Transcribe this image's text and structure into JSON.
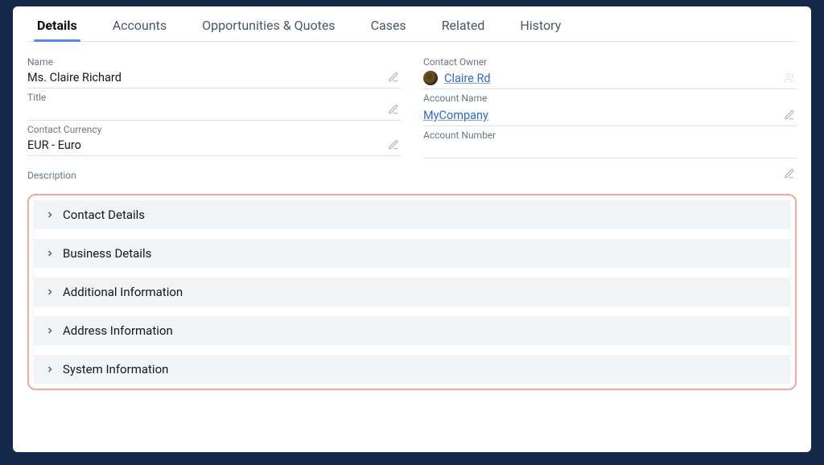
{
  "tabs": {
    "details": "Details",
    "accounts": "Accounts",
    "opps": "Opportunities & Quotes",
    "cases": "Cases",
    "related": "Related",
    "history": "History"
  },
  "fields": {
    "name": {
      "label": "Name",
      "value": "Ms. Claire Richard"
    },
    "title": {
      "label": "Title",
      "value": ""
    },
    "currency": {
      "label": "Contact Currency",
      "value": "EUR - Euro"
    },
    "description": {
      "label": "Description",
      "value": ""
    },
    "owner": {
      "label": "Contact Owner",
      "value": "Claire Rd"
    },
    "accountName": {
      "label": "Account Name",
      "value": "MyCompany"
    },
    "accountNumber": {
      "label": "Account Number",
      "value": ""
    }
  },
  "sections": {
    "contact": "Contact Details",
    "business": "Business Details",
    "additional": "Additional Information",
    "address": "Address Information",
    "system": "System Information"
  }
}
